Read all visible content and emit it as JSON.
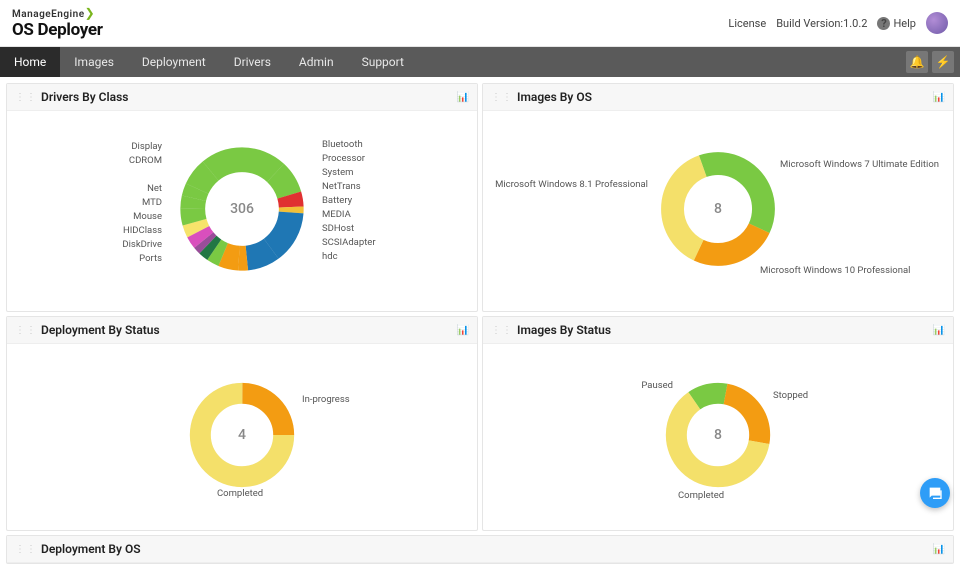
{
  "brand": {
    "company": "ManageEngine",
    "product": "OS Deployer"
  },
  "top": {
    "license": "License",
    "build_label": "Build Version:",
    "build_value": "1.0.2",
    "help": "Help"
  },
  "nav": {
    "items": [
      "Home",
      "Images",
      "Deployment",
      "Drivers",
      "Admin",
      "Support"
    ],
    "active": 0
  },
  "panels": {
    "drivers_by_class": {
      "title": "Drivers By Class",
      "center": "306",
      "left_labels": [
        "Display",
        "CDROM",
        "Net",
        "MTD",
        "Mouse",
        "HIDClass",
        "DiskDrive",
        "Ports"
      ],
      "right_labels": [
        "Bluetooth",
        "Processor",
        "System",
        "NetTrans",
        "Battery",
        "MEDIA",
        "SDHost",
        "SCSIAdapter",
        "hdc"
      ]
    },
    "images_by_os": {
      "title": "Images By OS",
      "center": "8",
      "labels": {
        "left": "Microsoft Windows 8.1 Professional",
        "right": "Microsoft Windows 7 Ultimate Edition",
        "bottom": "Microsoft Windows 10 Professional"
      }
    },
    "deployment_by_status": {
      "title": "Deployment By Status",
      "center": "4",
      "labels": {
        "right": "In-progress",
        "bottom": "Completed"
      }
    },
    "images_by_status": {
      "title": "Images By Status",
      "center": "8",
      "labels": {
        "left": "Paused",
        "right": "Stopped",
        "bottom": "Completed"
      }
    },
    "deployment_by_os": {
      "title": "Deployment By OS"
    }
  },
  "chart_data": [
    {
      "id": "drivers_by_class",
      "type": "donut",
      "total": 306,
      "series": [
        {
          "name": "Net",
          "value": 70,
          "color": "#7ac943"
        },
        {
          "name": "Display",
          "value": 26,
          "color": "#7ac943"
        },
        {
          "name": "Bluetooth",
          "value": 12,
          "color": "#e03131"
        },
        {
          "name": "Processor",
          "value": 6,
          "color": "#f2c037"
        },
        {
          "name": "System",
          "value": 42,
          "color": "#1f77b4"
        },
        {
          "name": "NetTrans",
          "value": 26,
          "color": "#1f77b4"
        },
        {
          "name": "Battery",
          "value": 8,
          "color": "#f39c12"
        },
        {
          "name": "MEDIA",
          "value": 16,
          "color": "#f39c12"
        },
        {
          "name": "SDHost",
          "value": 10,
          "color": "#7ac943"
        },
        {
          "name": "SCSIAdapter",
          "value": 8,
          "color": "#227744"
        },
        {
          "name": "hdc",
          "value": 6,
          "color": "#994d99"
        },
        {
          "name": "Ports",
          "value": 10,
          "color": "#d94fbd"
        },
        {
          "name": "DiskDrive",
          "value": 10,
          "color": "#f6e36b"
        },
        {
          "name": "HIDClass",
          "value": 14,
          "color": "#7ac943"
        },
        {
          "name": "Mouse",
          "value": 10,
          "color": "#7ac943"
        },
        {
          "name": "MTD",
          "value": 10,
          "color": "#7ac943"
        },
        {
          "name": "CDROM",
          "value": 22,
          "color": "#7ac943"
        }
      ]
    },
    {
      "id": "images_by_os",
      "type": "donut",
      "total": 8,
      "series": [
        {
          "name": "Microsoft Windows 8.1 Professional",
          "value": 3,
          "color": "#7ac943"
        },
        {
          "name": "Microsoft Windows 7 Ultimate Edition",
          "value": 2,
          "color": "#f39c12"
        },
        {
          "name": "Microsoft Windows 10 Professional",
          "value": 3,
          "color": "#f4e06a"
        }
      ]
    },
    {
      "id": "deployment_by_status",
      "type": "donut",
      "total": 4,
      "series": [
        {
          "name": "In-progress",
          "value": 1,
          "color": "#f39c12"
        },
        {
          "name": "Completed",
          "value": 3,
          "color": "#f4e06a"
        }
      ]
    },
    {
      "id": "images_by_status",
      "type": "donut",
      "total": 8,
      "series": [
        {
          "name": "Paused",
          "value": 1,
          "color": "#7ac943"
        },
        {
          "name": "Stopped",
          "value": 2,
          "color": "#f39c12"
        },
        {
          "name": "Completed",
          "value": 5,
          "color": "#f4e06a"
        }
      ]
    }
  ]
}
